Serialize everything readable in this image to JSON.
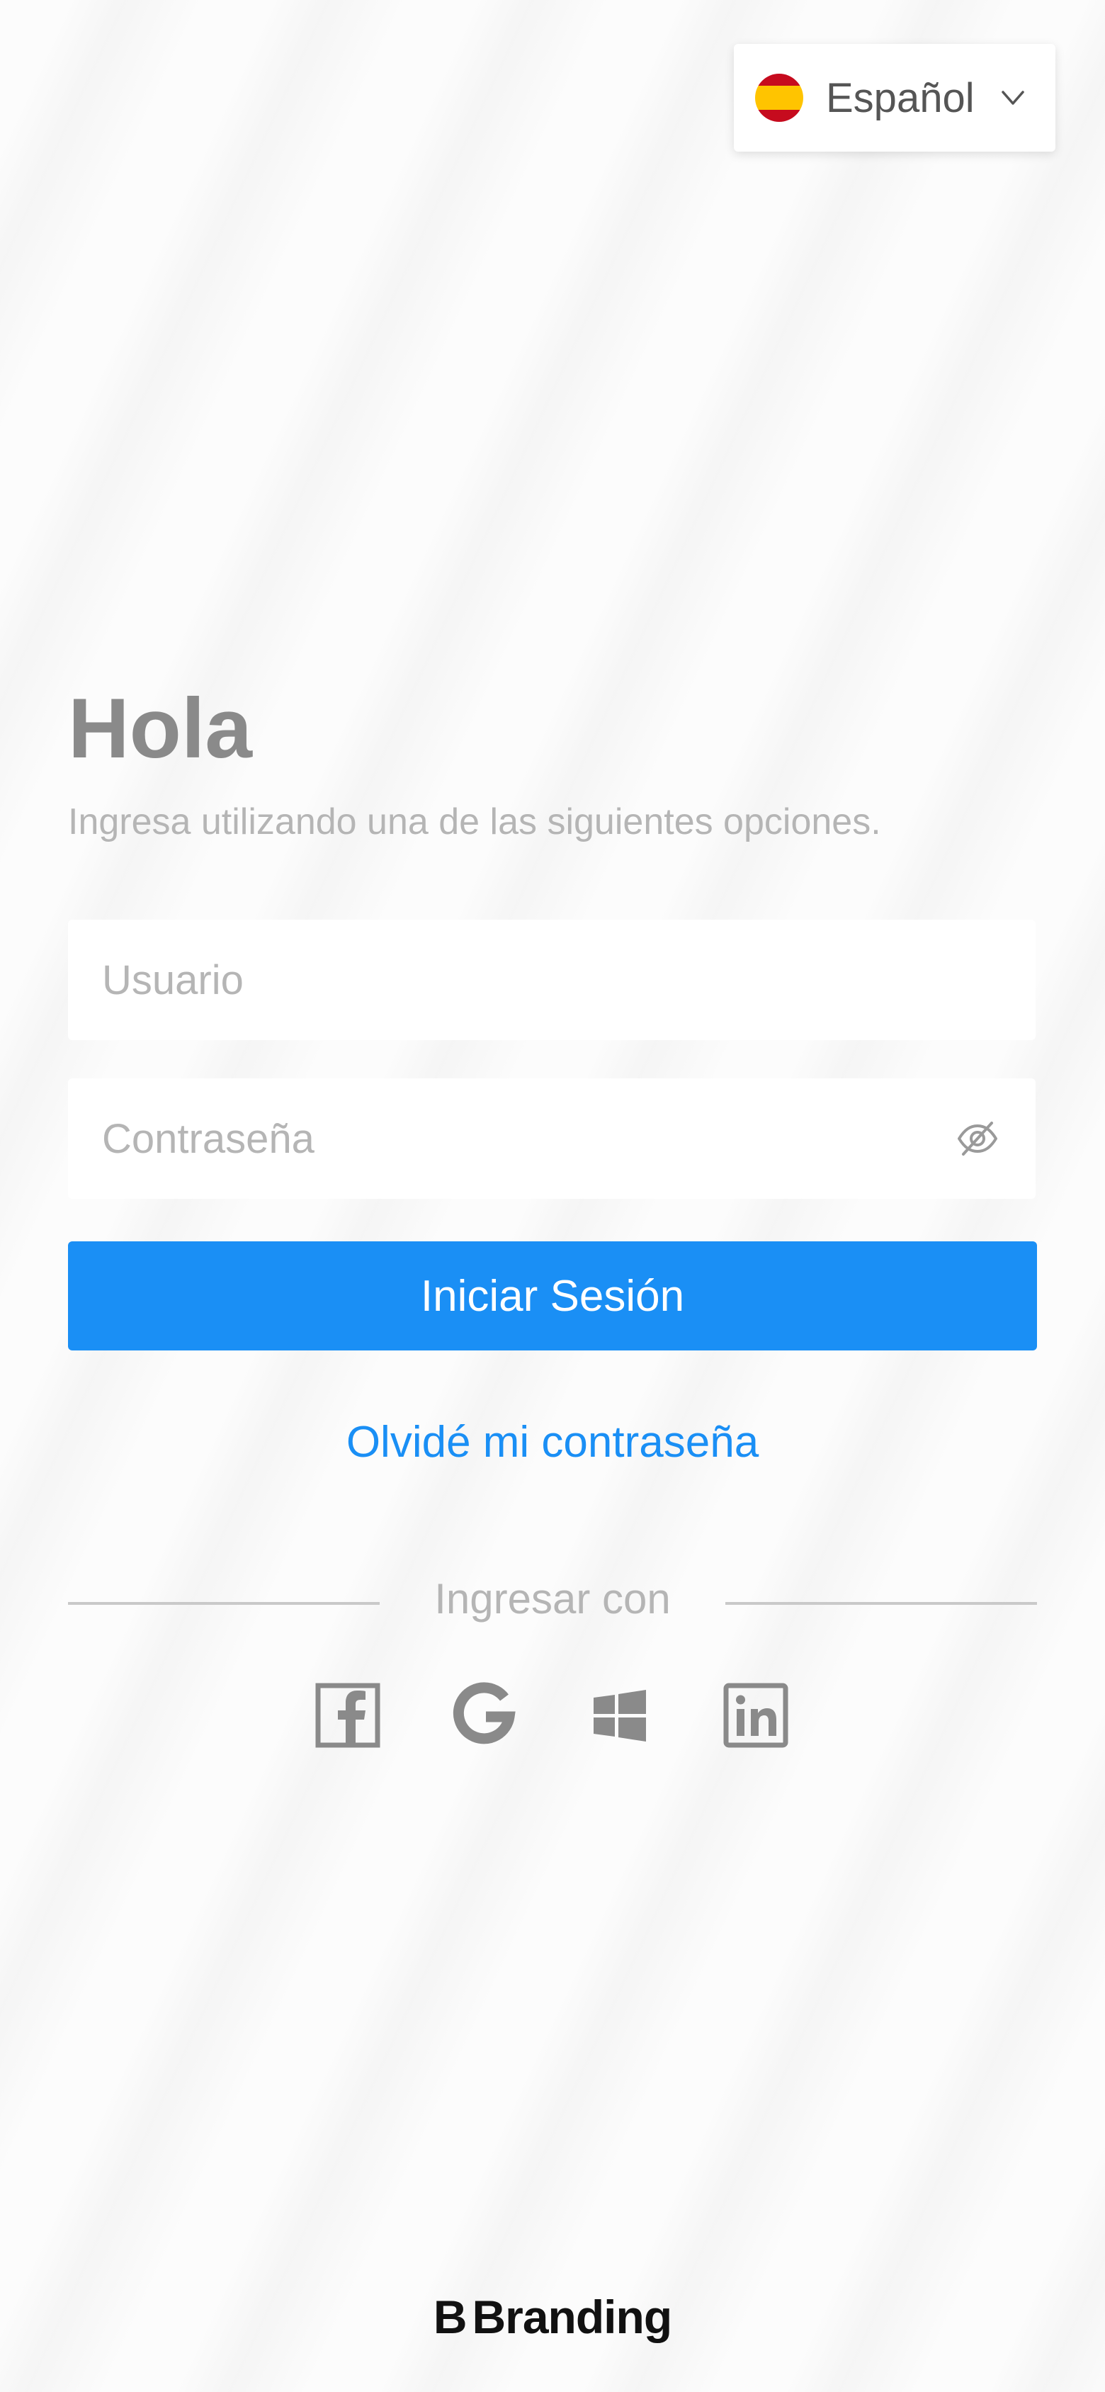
{
  "language_selector": {
    "label": "Español",
    "flag_icon": "spain-flag-icon",
    "chevron_icon": "chevron-down-icon"
  },
  "greeting": {
    "title": "Hola",
    "subtitle": "Ingresa utilizando una de las siguientes opciones."
  },
  "form": {
    "username_placeholder": "Usuario",
    "username_value": "",
    "password_placeholder": "Contraseña",
    "password_value": "",
    "password_toggle_icon": "eye-off-icon",
    "login_label": "Iniciar Sesión",
    "forgot_label": "Olvidé mi contraseña"
  },
  "social": {
    "divider_label": "Ingresar con",
    "providers": [
      {
        "name": "Facebook",
        "icon": "facebook-icon"
      },
      {
        "name": "Google",
        "icon": "google-icon"
      },
      {
        "name": "Windows",
        "icon": "windows-icon"
      },
      {
        "name": "LinkedIn",
        "icon": "linkedin-icon"
      }
    ]
  },
  "footer": {
    "brand_mark": "B",
    "brand_name": "Branding"
  },
  "colors": {
    "primary": "#1a8ff5",
    "heading": "#8a8a8a",
    "muted": "#b5b5b5",
    "social_icon": "#8a8a8a"
  }
}
